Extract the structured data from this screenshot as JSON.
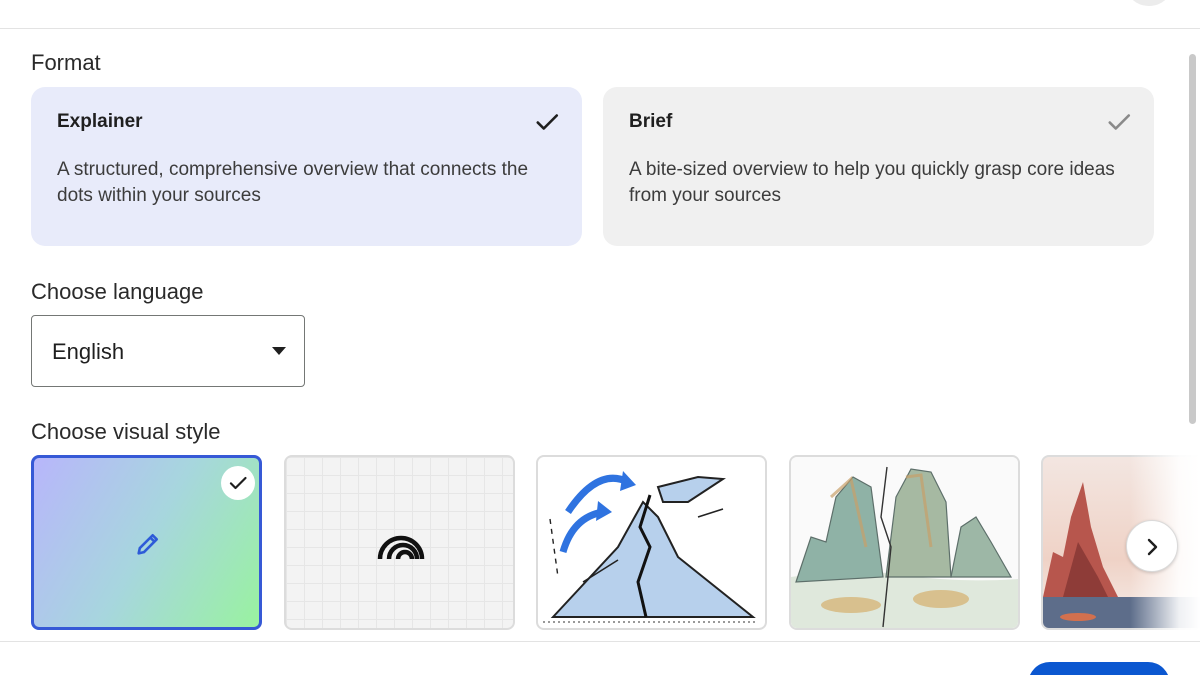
{
  "format": {
    "label": "Format",
    "options": [
      {
        "title": "Explainer",
        "description": "A structured, comprehensive overview that connects the dots within your sources",
        "selected": true
      },
      {
        "title": "Brief",
        "description": "A bite-sized overview to help you quickly grasp core ideas from your sources",
        "selected": false
      }
    ]
  },
  "language": {
    "label": "Choose language",
    "selected": "English"
  },
  "visual_style": {
    "label": "Choose visual style",
    "tiles": [
      {
        "icon": "pencil-icon",
        "selected": true
      },
      {
        "icon": "rainbow-icon",
        "selected": false
      },
      {
        "icon": "sketch-illustration",
        "selected": false
      },
      {
        "icon": "watercolor-illustration",
        "selected": false
      },
      {
        "icon": "landscape-illustration",
        "selected": false
      }
    ]
  },
  "colors": {
    "accent": "#0b57d0",
    "selected_card": "#e8ebfa",
    "unselected_card": "#f0f0f0",
    "tile_selected_border": "#3659d6"
  }
}
